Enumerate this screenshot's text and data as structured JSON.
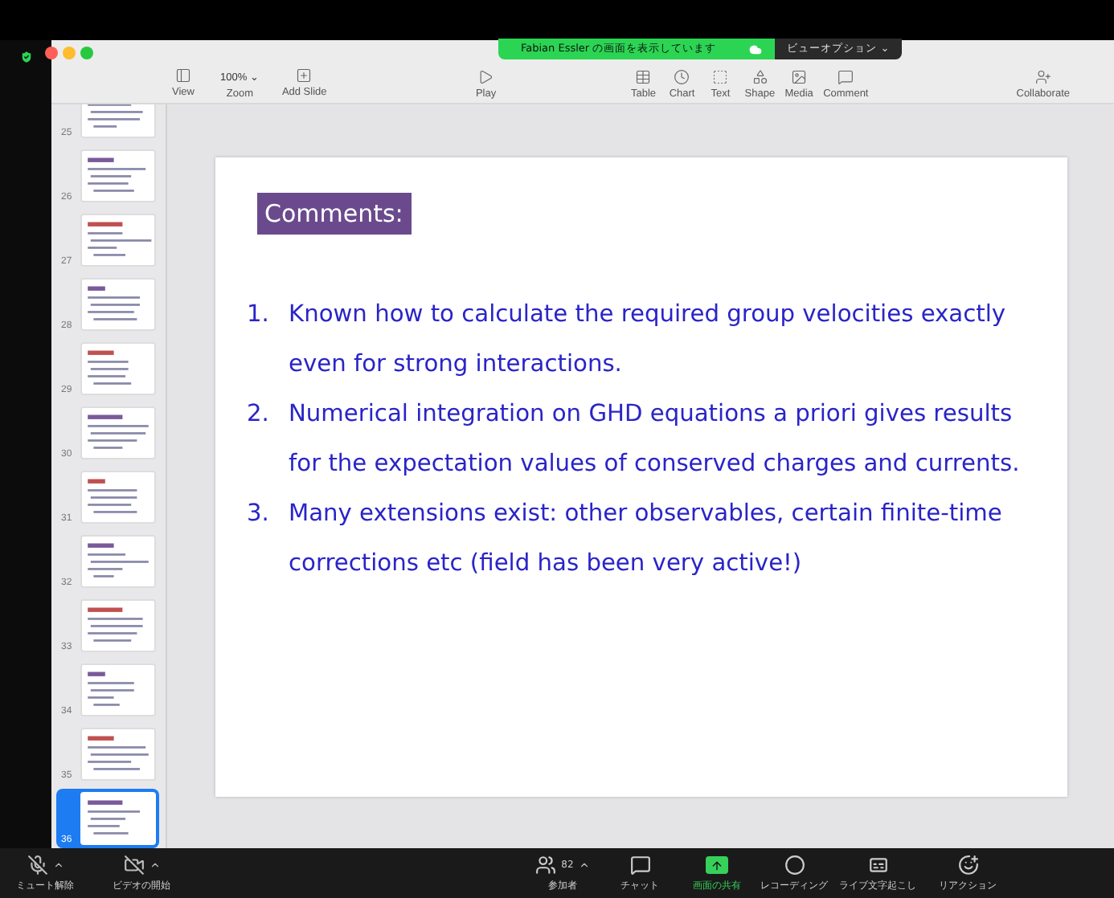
{
  "share_banner": {
    "text": "Fabian Essler の画面を表示しています",
    "view_options": "ビューオプション ⌄"
  },
  "toolbar": {
    "groups": [
      [
        {
          "kind": "button",
          "label": "View"
        },
        {
          "kind": "dropdown",
          "value": "100% ⌄",
          "label": "Zoom"
        },
        {
          "kind": "button",
          "label": "Add Slide"
        }
      ],
      [
        {
          "kind": "button",
          "label": "Play"
        }
      ],
      [
        {
          "kind": "button",
          "label": "Table"
        },
        {
          "kind": "button",
          "label": "Chart"
        },
        {
          "kind": "button",
          "label": "Text"
        },
        {
          "kind": "button",
          "label": "Shape"
        },
        {
          "kind": "button",
          "label": "Media"
        },
        {
          "kind": "button",
          "label": "Comment"
        }
      ],
      [
        {
          "kind": "button",
          "label": "Collaborate"
        }
      ]
    ]
  },
  "slides": [
    {
      "number": "25",
      "selected": false
    },
    {
      "number": "26",
      "selected": false
    },
    {
      "number": "27",
      "selected": false
    },
    {
      "number": "28",
      "selected": false
    },
    {
      "number": "29",
      "selected": false
    },
    {
      "number": "30",
      "selected": false
    },
    {
      "number": "31",
      "selected": false
    },
    {
      "number": "32",
      "selected": false
    },
    {
      "number": "33",
      "selected": false
    },
    {
      "number": "34",
      "selected": false
    },
    {
      "number": "35",
      "selected": false
    },
    {
      "number": "36",
      "selected": true
    }
  ],
  "slide": {
    "heading": "Comments:",
    "items": [
      {
        "number": "1.",
        "text": "Known how to calculate the required group velocities exactly even for strong interactions."
      },
      {
        "number": "2.",
        "text": "Numerical integration on GHD equations a priori gives results for the expectation values of conserved charges and currents."
      },
      {
        "number": "3.",
        "text": "Many extensions exist: other observables, certain finite-time corrections etc (field has been very active!)"
      }
    ]
  },
  "meeting_controls": [
    {
      "label": "ミュート解除",
      "caret": true
    },
    {
      "label": "ビデオの開始",
      "caret": true
    },
    {
      "label": "参加者",
      "count": "82",
      "caret": true
    },
    {
      "label": "チャット",
      "caret": false
    },
    {
      "label": "画面の共有",
      "caret": false,
      "selected": true
    },
    {
      "label": "レコーディング",
      "caret": false
    },
    {
      "label": "ライブ文字起こし",
      "caret": false
    },
    {
      "label": "リアクション",
      "caret": false
    }
  ]
}
